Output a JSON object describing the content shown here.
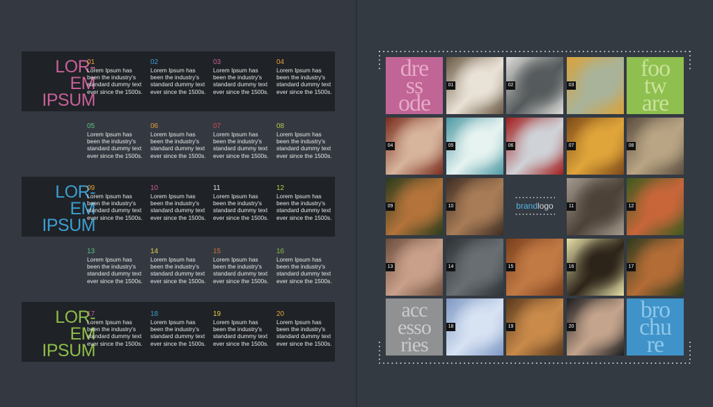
{
  "left_page": {
    "bands": [
      {
        "title": [
          "LOR-",
          "EM",
          "IPSUM"
        ],
        "color": "#c9609a"
      },
      {
        "title": [
          "LOR-",
          "EM",
          "IPSUM"
        ],
        "color": "#3d9ed3"
      },
      {
        "title": [
          "LOR-",
          "EM",
          "IPSUM"
        ],
        "color": "#8ebd4a"
      }
    ],
    "body_text": "Lorem Ipsum has been the industry's standard dummy text ever since the 1500s.",
    "items": [
      {
        "num": "01",
        "color": "#e8a13a"
      },
      {
        "num": "02",
        "color": "#3d9ed3"
      },
      {
        "num": "03",
        "color": "#c9609a"
      },
      {
        "num": "04",
        "color": "#e8a13a"
      },
      {
        "num": "05",
        "color": "#5fbf7f"
      },
      {
        "num": "06",
        "color": "#e8a13a"
      },
      {
        "num": "07",
        "color": "#d04c4c"
      },
      {
        "num": "08",
        "color": "#b9c94a"
      },
      {
        "num": "09",
        "color": "#e8a13a"
      },
      {
        "num": "10",
        "color": "#c9609a"
      },
      {
        "num": "11",
        "color": "#e0e0e0"
      },
      {
        "num": "12",
        "color": "#b9c94a"
      },
      {
        "num": "13",
        "color": "#5fbf7f"
      },
      {
        "num": "14",
        "color": "#e8d04a"
      },
      {
        "num": "15",
        "color": "#d0703a"
      },
      {
        "num": "16",
        "color": "#8ebd4a"
      },
      {
        "num": "17",
        "color": "#c9609a"
      },
      {
        "num": "18",
        "color": "#3d9ed3"
      },
      {
        "num": "19",
        "color": "#e8d04a"
      },
      {
        "num": "20",
        "color": "#e8a13a"
      }
    ]
  },
  "right_page": {
    "word_tiles": {
      "dresscode": {
        "lines": [
          "dre",
          "ss",
          "ode"
        ],
        "bg": "#c06595",
        "fg": "#e7a9c8"
      },
      "footware": {
        "lines": [
          "foo",
          "tw",
          "are"
        ],
        "bg": "#8fbf4e",
        "fg": "#c8e39a"
      },
      "accessories": {
        "lines": [
          "acc",
          "esso",
          "ries"
        ],
        "bg": "#8f9193",
        "fg": "#c9cbcd"
      },
      "brochure": {
        "lines": [
          "bro",
          "chu",
          "re"
        ],
        "bg": "#3f93c9",
        "fg": "#8ec7ea"
      }
    },
    "brand": {
      "part1": "brand",
      "part2": "logo"
    },
    "photos": [
      {
        "badge": "01",
        "bg": "#6b5a45",
        "accent": "#e9e2d6"
      },
      {
        "badge": "02",
        "bg": "#dcdcd8",
        "accent": "#555a5c"
      },
      {
        "badge": "03",
        "bg": "#d9a33b",
        "accent": "#a8b39a"
      },
      {
        "badge": "04",
        "bg": "#7a2e1f",
        "accent": "#d7b49c"
      },
      {
        "badge": "05",
        "bg": "#4f9aa5",
        "accent": "#e6f3f0"
      },
      {
        "badge": "06",
        "bg": "#a21d1d",
        "accent": "#cfd3d8"
      },
      {
        "badge": "07",
        "bg": "#7e4a18",
        "accent": "#e0a53a"
      },
      {
        "badge": "08",
        "bg": "#5b4e40",
        "accent": "#b9a584"
      },
      {
        "badge": "09",
        "bg": "#2a3b1c",
        "accent": "#b4733a"
      },
      {
        "badge": "10",
        "bg": "#3e2e24",
        "accent": "#a87c56"
      },
      {
        "badge": "11",
        "bg": "#a49a8e",
        "accent": "#4d4237"
      },
      {
        "badge": "12",
        "bg": "#3c5a1e",
        "accent": "#c8663a"
      },
      {
        "badge": "13",
        "bg": "#6b4d3d",
        "accent": "#c9a08a"
      },
      {
        "badge": "14",
        "bg": "#2e3235",
        "accent": "#686e72"
      },
      {
        "badge": "15",
        "bg": "#7a3f1d",
        "accent": "#c27a44"
      },
      {
        "badge": "16",
        "bg": "#e6e0a8",
        "accent": "#2d2419"
      },
      {
        "badge": "17",
        "bg": "#2d3a1e",
        "accent": "#b46c36"
      },
      {
        "badge": "18",
        "bg": "#7f99c4",
        "accent": "#d7e2f3"
      },
      {
        "badge": "19",
        "bg": "#5a3a1d",
        "accent": "#c98a4a"
      },
      {
        "badge": "20",
        "bg": "#1c1d20",
        "accent": "#c4a48c"
      }
    ]
  }
}
